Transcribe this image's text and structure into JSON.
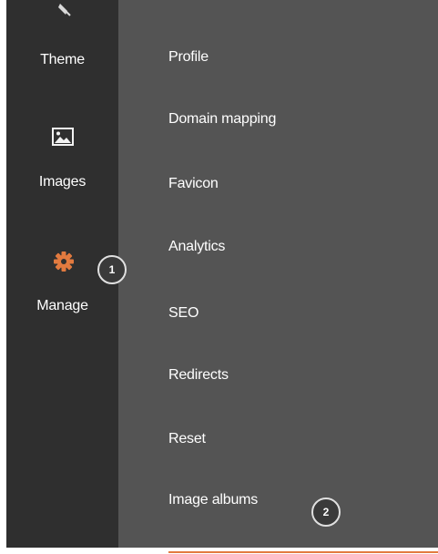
{
  "sidebar": {
    "items": [
      {
        "label": "Theme",
        "icon": "brush-icon"
      },
      {
        "label": "Images",
        "icon": "image-icon"
      },
      {
        "label": "Manage",
        "icon": "gear-icon",
        "active": true
      }
    ]
  },
  "menu": {
    "items": [
      {
        "label": "Profile"
      },
      {
        "label": "Domain mapping"
      },
      {
        "label": "Favicon"
      },
      {
        "label": "Analytics"
      },
      {
        "label": "SEO"
      },
      {
        "label": "Redirects"
      },
      {
        "label": "Reset"
      },
      {
        "label": "Image albums",
        "active": true
      }
    ]
  },
  "callouts": [
    {
      "number": "1"
    },
    {
      "number": "2"
    }
  ],
  "colors": {
    "sidebar_bg": "#2f2f2f",
    "panel_bg": "#545454",
    "accent": "#e27a3f",
    "text": "#ffffff"
  }
}
